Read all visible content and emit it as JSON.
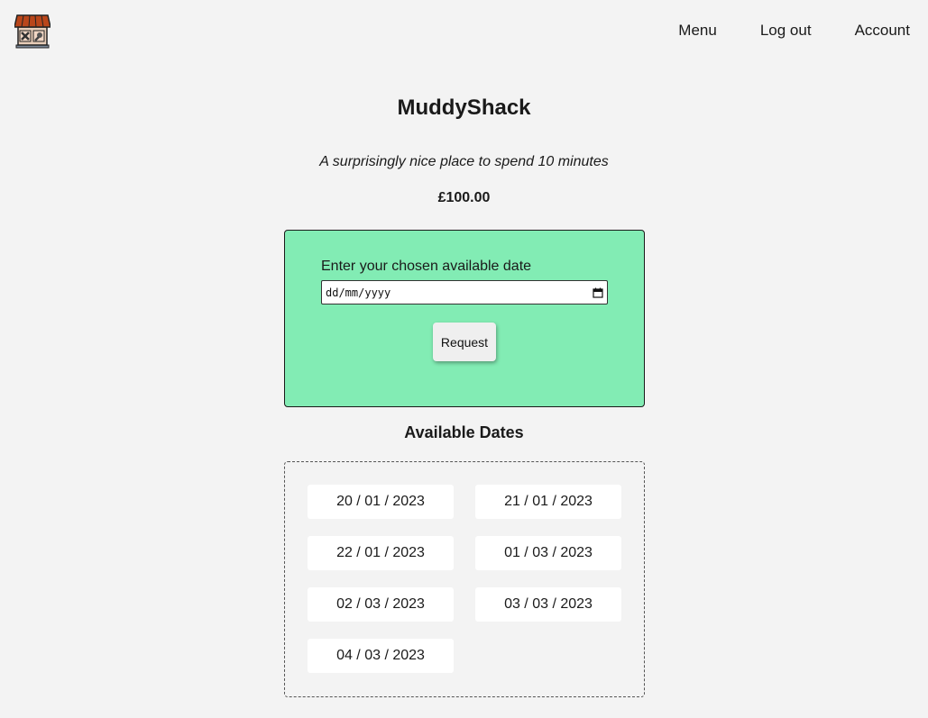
{
  "header": {
    "logo_icon": "shop-building-icon",
    "nav": [
      {
        "label": "Menu"
      },
      {
        "label": "Log out"
      },
      {
        "label": "Account"
      }
    ]
  },
  "listing": {
    "title": "MuddyShack",
    "description": "A surprisingly nice place to spend 10 minutes",
    "price": "£100.00"
  },
  "request_form": {
    "label": "Enter your chosen available date",
    "date_placeholder": "dd/mm/yyyy",
    "date_value": "",
    "calendar_icon": "calendar-icon",
    "button_label": "Request"
  },
  "available": {
    "heading": "Available Dates",
    "dates": [
      "20 / 01 / 2023",
      "21 / 01 / 2023",
      "22 / 01 / 2023",
      "01 / 03 / 2023",
      "02 / 03 / 2023",
      "03 / 03 / 2023",
      "04 / 03 / 2023"
    ]
  },
  "colors": {
    "background": "#f3f3f3",
    "request_panel": "#82ecb4",
    "chip": "#ffffff"
  }
}
